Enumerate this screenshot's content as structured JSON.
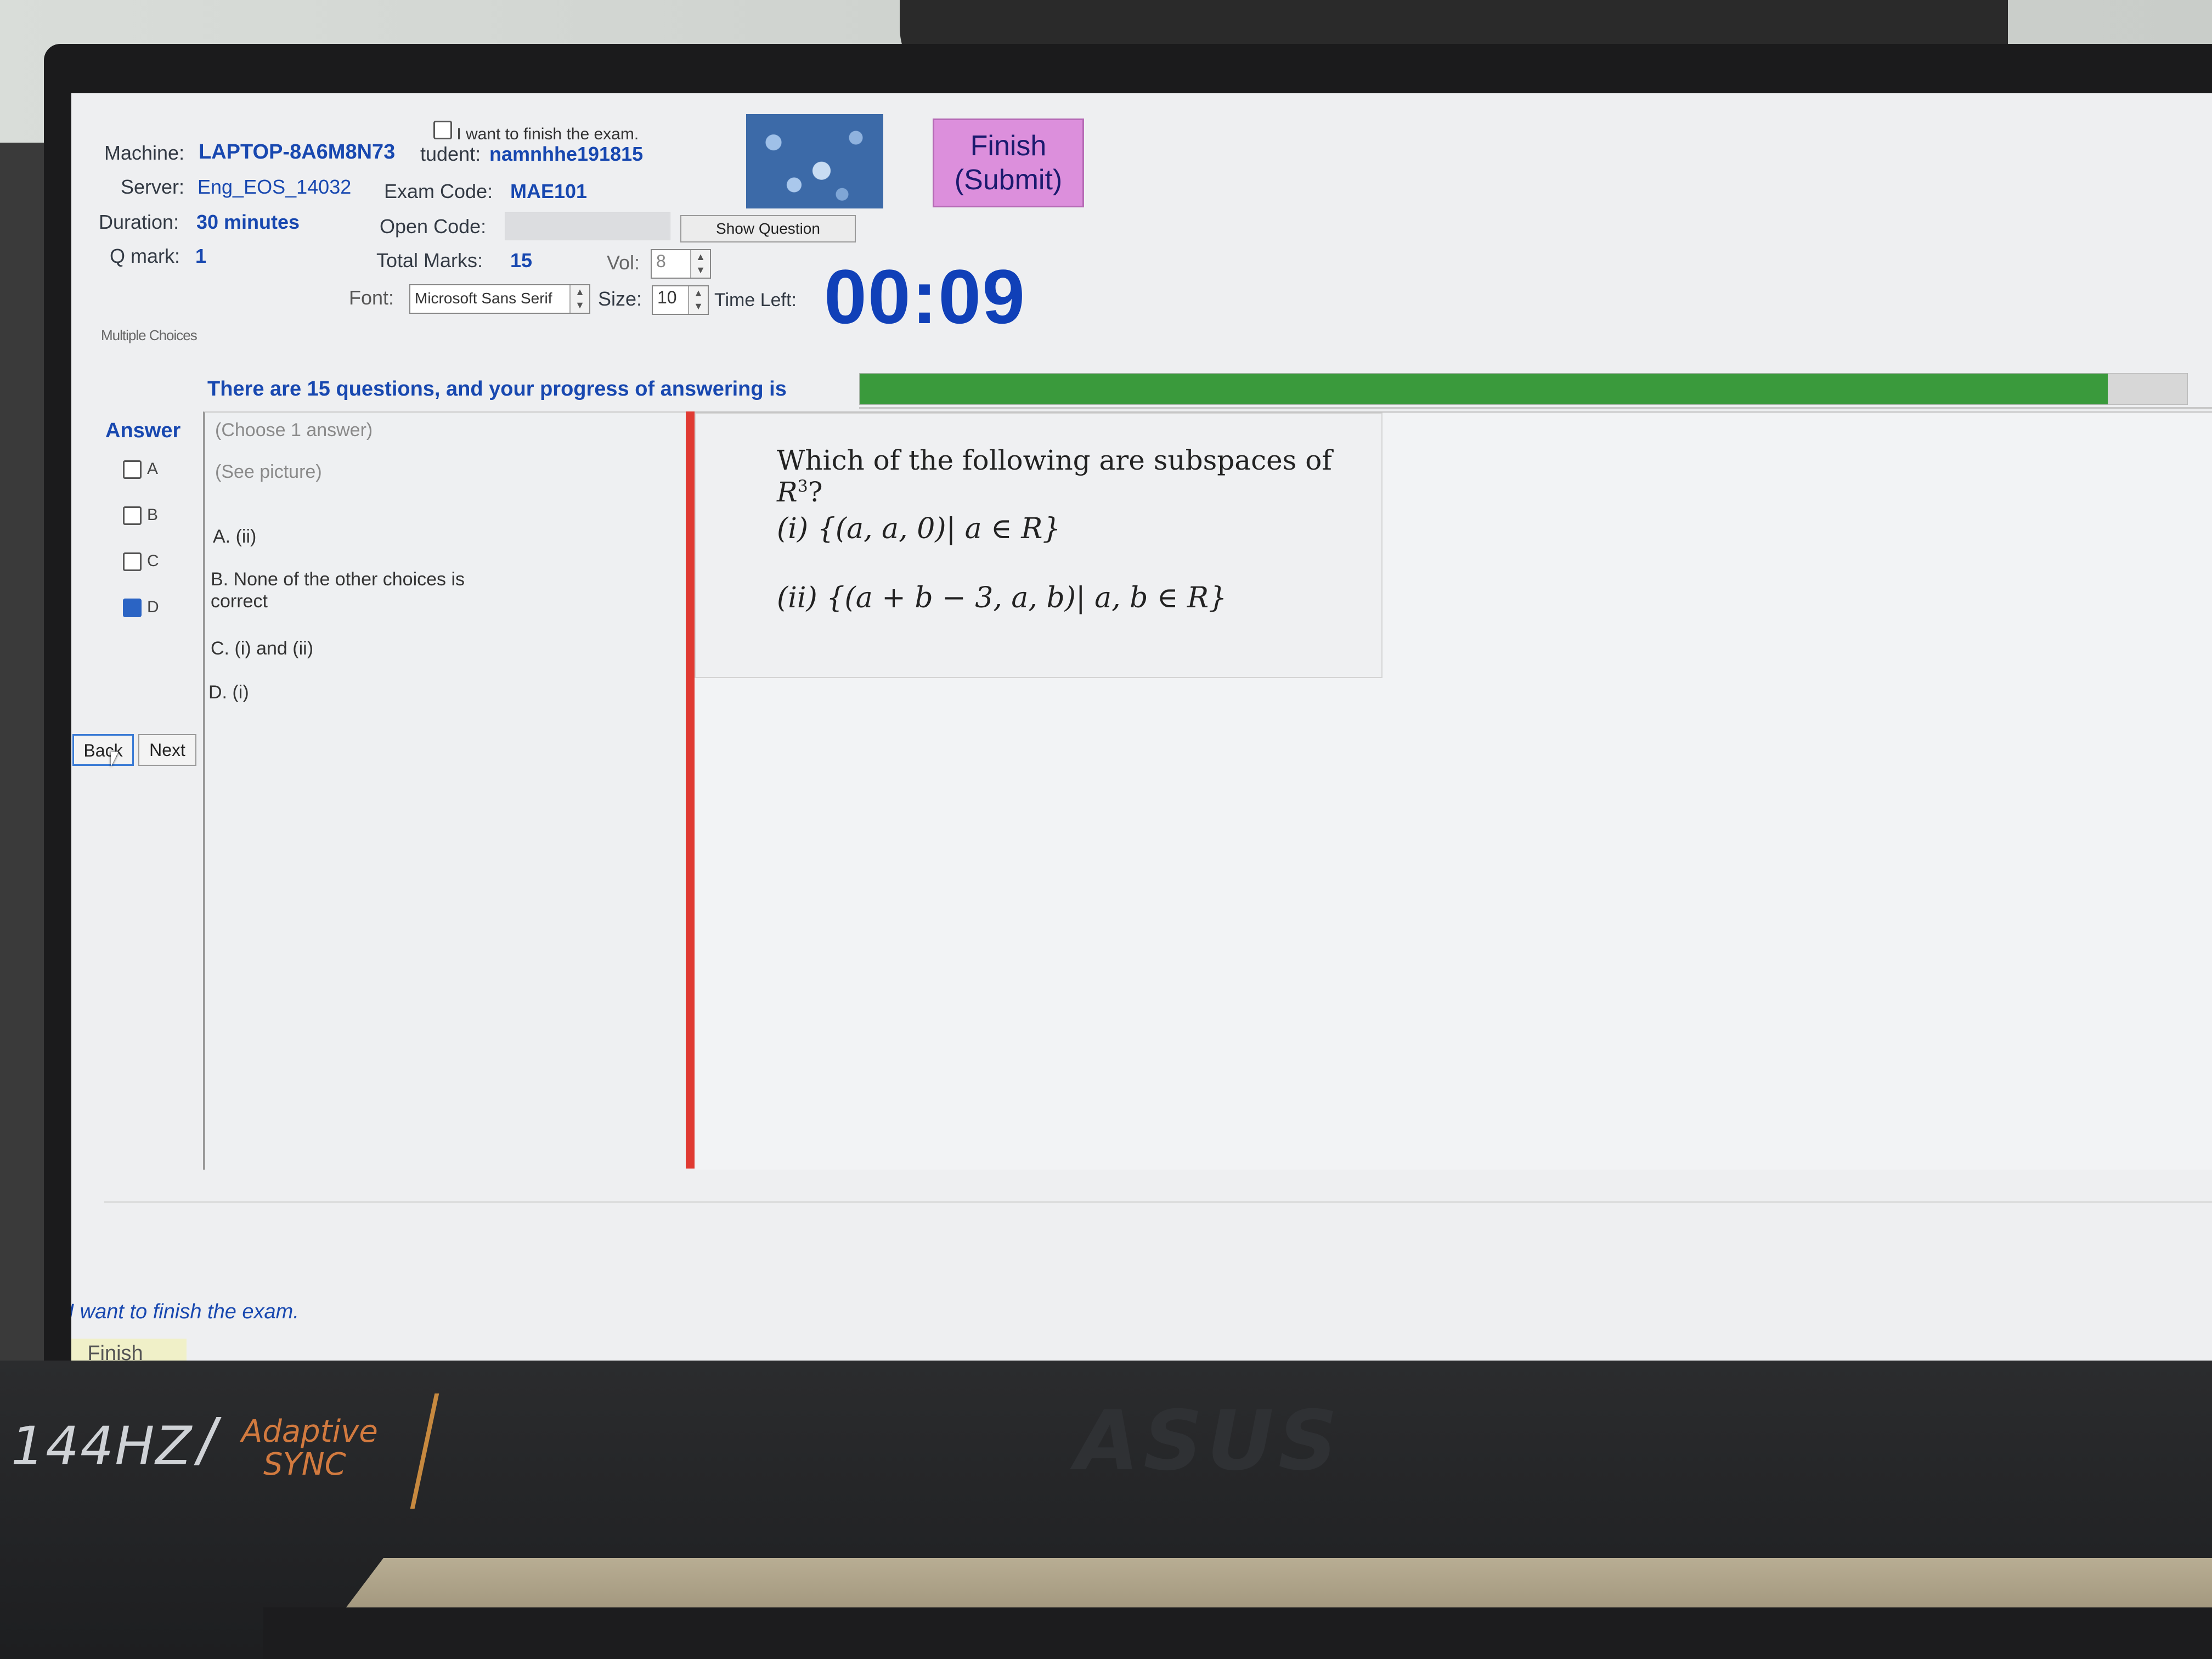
{
  "header": {
    "finish_checkbox_top_label": "I want to finish the exam.",
    "machine_label": "Machine:",
    "machine_value": "LAPTOP-8A6M8N73",
    "student_label": "tudent:",
    "student_value": "namnhhe191815",
    "server_label": "Server:",
    "server_value": "Eng_EOS_14032",
    "exam_code_label": "Exam Code:",
    "exam_code_value": "MAE101",
    "duration_label": "Duration:",
    "duration_value": "30 minutes",
    "open_code_label": "Open Code:",
    "show_question_label": "Show Question",
    "q_mark_label": "Q mark:",
    "q_mark_value": "1",
    "total_marks_label": "Total Marks:",
    "total_marks_value": "15",
    "vol_label": "Vol:",
    "vol_value": "8",
    "font_label": "Font:",
    "font_value": "Microsoft Sans Serif",
    "size_label": "Size:",
    "size_value": "10",
    "time_left_label": "Time Left:",
    "time_left_value": "00:09",
    "finish_submit_label": "Finish\n(Submit)"
  },
  "section_label": "Multiple Choices",
  "progress": {
    "text": "There are 15 questions, and your progress of answering is",
    "fraction": 0.94,
    "fill_color": "#3a9a3c"
  },
  "answer": {
    "heading": "Answer",
    "options": [
      {
        "letter": "A",
        "checked": false
      },
      {
        "letter": "B",
        "checked": false
      },
      {
        "letter": "C",
        "checked": false
      },
      {
        "letter": "D",
        "checked": true
      }
    ]
  },
  "choices_panel": {
    "instruction": "(Choose 1 answer)",
    "see_picture": "(See picture)",
    "choice_a": "A. (ii)",
    "choice_b": "B. None of the other choices is correct",
    "choice_c": "C. (i) and (ii)",
    "choice_d": "D. (i)"
  },
  "nav": {
    "back": "Back",
    "next": "Next"
  },
  "question": {
    "prompt_text": "Which of the following are subspaces of ",
    "prompt_var": "R",
    "prompt_sup": "3",
    "prompt_end": "?",
    "item_i": "(i) {(a, a, 0)|  a ∈ R}",
    "item_ii": "(ii) {(a + b − 3, a, b)|  a, b ∈ R}"
  },
  "footer": {
    "finish_checkbox_label": "I want to finish the exam.",
    "finish_button": "Finish"
  },
  "laptop": {
    "refresh": "144HZ",
    "adaptive": "Adaptive",
    "sync": "SYNC",
    "logo": "ASUS"
  },
  "colors": {
    "accent_blue": "#1848b0",
    "finish_button_bg": "#dc8fdc",
    "timer_blue": "#1040b8",
    "red_divider": "#e03a32"
  }
}
